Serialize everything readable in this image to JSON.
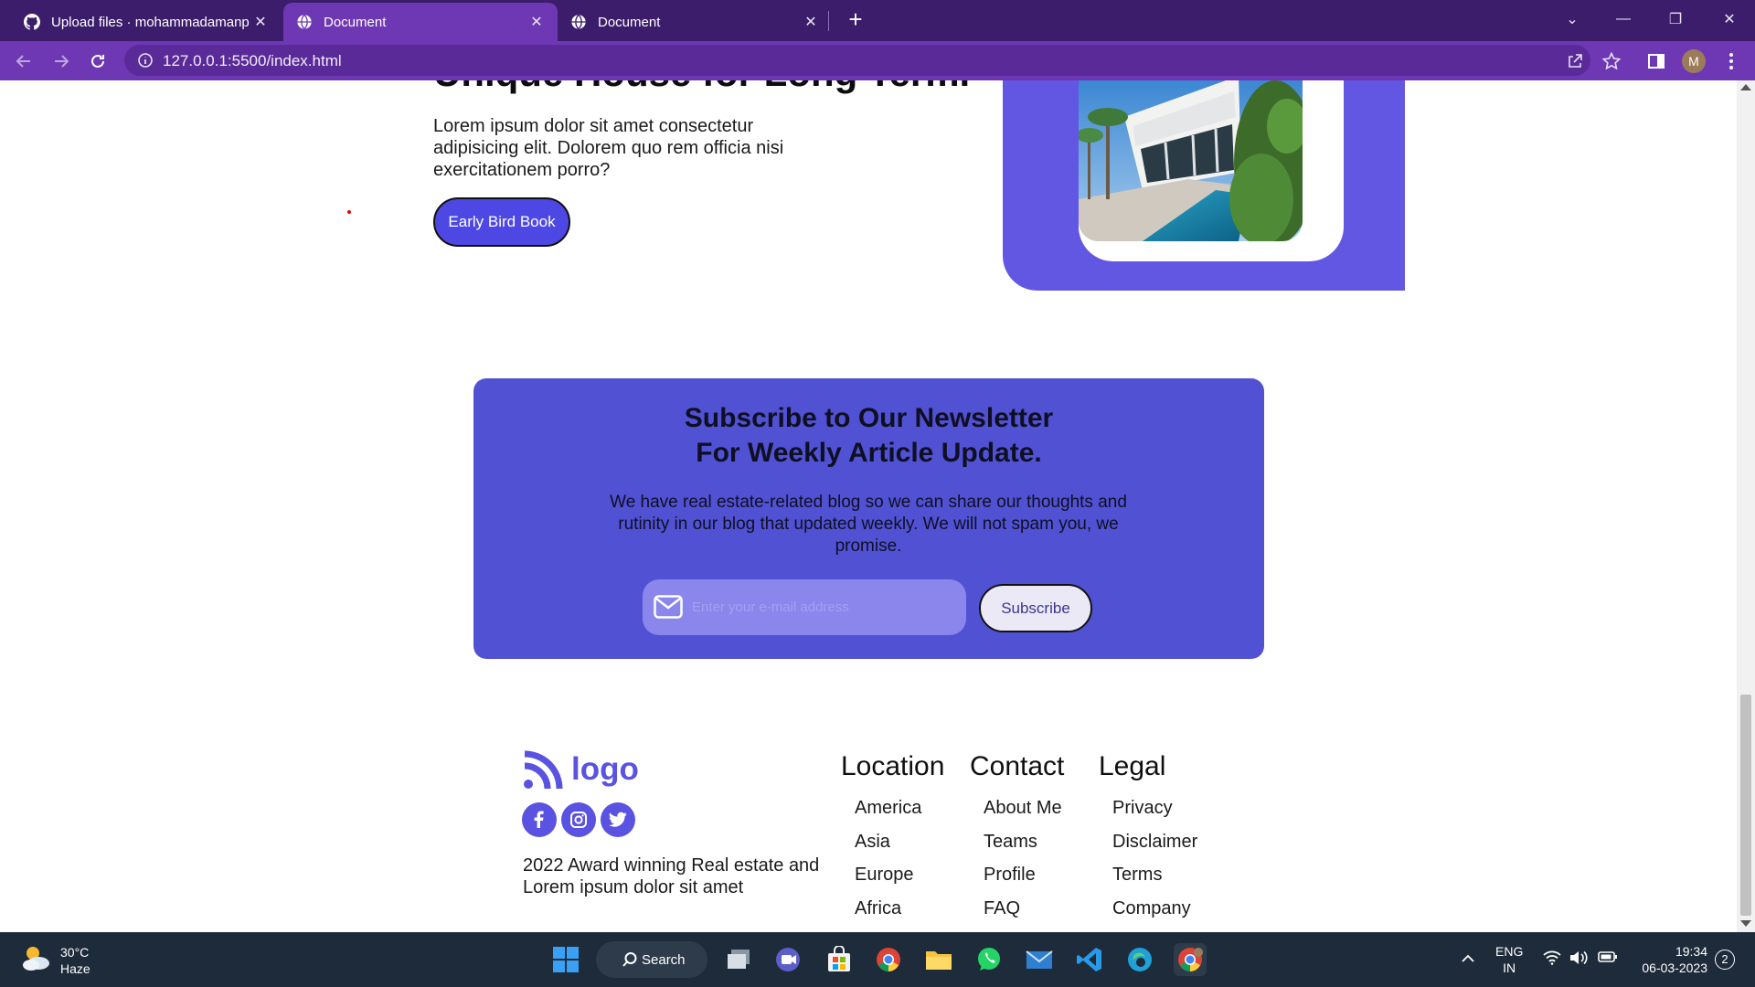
{
  "browser": {
    "tabs": [
      {
        "title": "Upload files · mohammadamanp"
      },
      {
        "title": "Document"
      },
      {
        "title": "Document"
      }
    ],
    "url": "127.0.0.1:5500/index.html",
    "profile_initial": "M"
  },
  "hero": {
    "title": "Unique House for Long Term.",
    "text": "Lorem ipsum dolor sit amet consectetur adipisicing elit. Dolorem quo rem officia nisi exercitationem porro?",
    "button": "Early Bird Book"
  },
  "newsletter": {
    "title_line1": "Subscribe to Our Newsletter",
    "title_line2": "For Weekly Article Update.",
    "text": "We have real estate-related blog so we can share our thoughts and rutinity in our blog that updated weekly. We will not spam you, we promise.",
    "placeholder": "Enter your e-mail address",
    "button": "Subscribe"
  },
  "footer": {
    "logo": "logo",
    "description": "2022 Award winning Real estate and Lorem ipsum dolor sit amet",
    "columns": [
      {
        "title": "Location",
        "links": [
          "America",
          "Asia",
          "Europe",
          "Africa"
        ]
      },
      {
        "title": "Contact",
        "links": [
          "About Me",
          "Teams",
          "Profile",
          "FAQ"
        ]
      },
      {
        "title": "Legal",
        "links": [
          "Privacy",
          "Disclaimer",
          "Terms",
          "Company"
        ]
      }
    ]
  },
  "taskbar": {
    "weather_temp": "30°C",
    "weather_desc": "Haze",
    "search_label": "Search",
    "lang_line1": "ENG",
    "lang_line2": "IN",
    "time": "19:34",
    "date": "06-03-2023",
    "notification_count": "2"
  },
  "colors": {
    "brand": "#5a52e0",
    "newsletter_bg": "#5151d4",
    "browser_frame": "#6e38b4"
  }
}
